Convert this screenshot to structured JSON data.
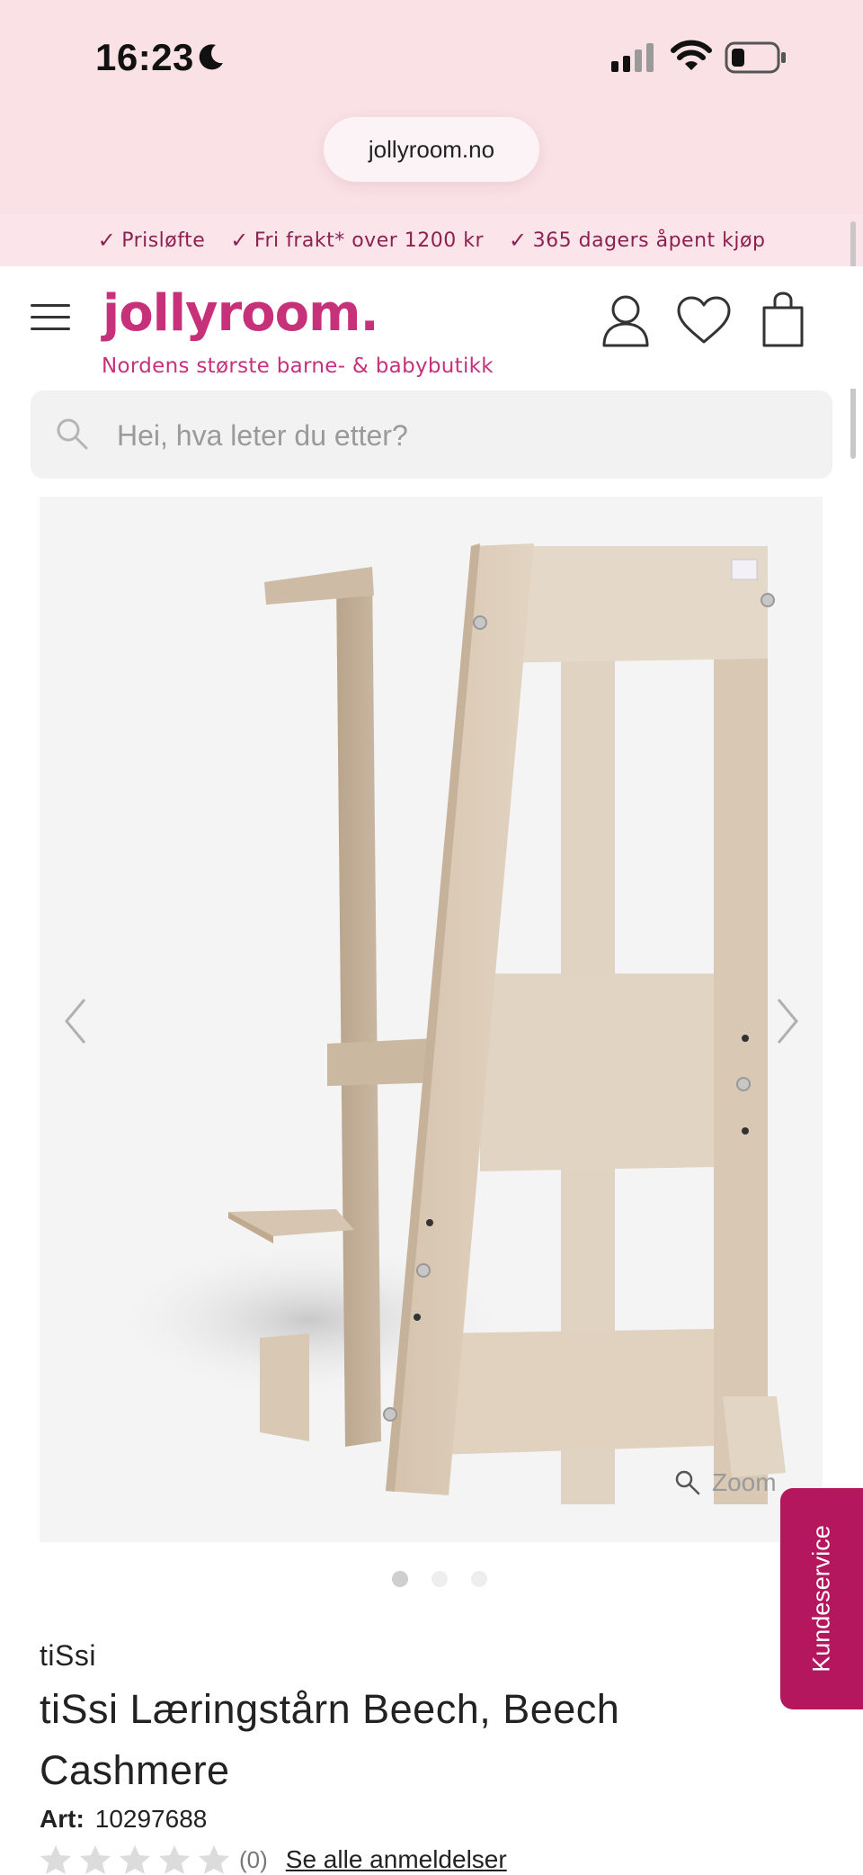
{
  "status_bar": {
    "time": "16:23"
  },
  "browser": {
    "url": "jollyroom.no"
  },
  "usp_bar": {
    "items": [
      "Prisløfte",
      "Fri frakt* over 1200 kr",
      "365 dagers åpent kjøp"
    ]
  },
  "header": {
    "logo": "jollyroom.",
    "tagline": "Nordens største barne- & babybutikk"
  },
  "search": {
    "placeholder": "Hei, hva leter du etter?"
  },
  "gallery": {
    "zoom_label": "Zoom",
    "image_count": 3,
    "active_index": 0
  },
  "product": {
    "brand": "tiSsi",
    "title": "tiSsi Læringstårn Beech, Beech Cashmere",
    "art_label": "Art:",
    "art_number": "10297688",
    "rating_count": "(0)",
    "reviews_link": "Se alle anmeldelser",
    "rating_stars": 0
  },
  "kundeservice": {
    "label": "Kundeservice"
  },
  "colors": {
    "brand_pink": "#c7317a",
    "usp_text": "#8e2051",
    "kundeservice_bg": "#b5175f",
    "top_bg": "#f9e1e5"
  }
}
